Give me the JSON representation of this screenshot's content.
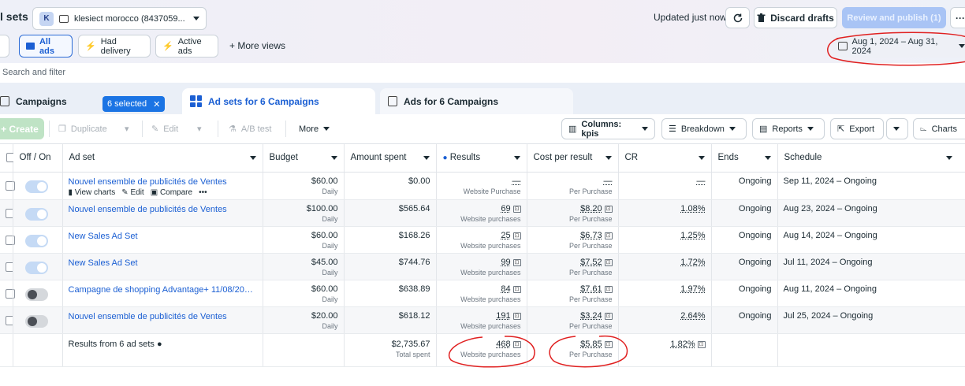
{
  "header": {
    "title": "l sets",
    "account_initial": "K",
    "account_name": "klesiect morocco (8437059...",
    "updated": "Updated just now",
    "discard": "Discard drafts",
    "publish": "Review and publish (1)",
    "more": "···"
  },
  "views": {
    "all_ads": "All ads",
    "had_delivery": "Had delivery",
    "active_ads": "Active ads",
    "more_views": "+  More views",
    "date_range": "Aug 1, 2024 – Aug 31, 2024"
  },
  "search": {
    "placeholder": "Search and filter"
  },
  "tabs": {
    "campaigns": "Campaigns",
    "selected": "6 selected",
    "adsets": "Ad sets for 6 Campaigns",
    "ads": "Ads for 6 Campaigns"
  },
  "toolbar": {
    "create": "+ Create",
    "duplicate": "Duplicate",
    "edit": "Edit",
    "ab_test": "A/B test",
    "more": "More",
    "columns": "Columns: kpis",
    "breakdown": "Breakdown",
    "reports": "Reports",
    "export": "Export",
    "charts": "Charts"
  },
  "columns": [
    "Off / On",
    "Ad set",
    "Budget",
    "Amount spent",
    "Results",
    "Cost per result",
    "CR",
    "Ends",
    "Schedule"
  ],
  "row_actions": [
    "View charts",
    "Edit",
    "Compare",
    "•••"
  ],
  "rows": [
    {
      "name": "Nouvel ensemble de publicités de Ventes",
      "on": true,
      "budget": "$60.00",
      "budget_type": "Daily",
      "spent": "$0.00",
      "results": "—",
      "results_sub": "Website Purchase",
      "cpr": "—",
      "cpr_sub": "Per Purchase",
      "cr": "—",
      "ends": "Ongoing",
      "schedule": "Sep 11, 2024 – Ongoing"
    },
    {
      "name": "Nouvel ensemble de publicités de Ventes",
      "on": true,
      "budget": "$100.00",
      "budget_type": "Daily",
      "spent": "$565.64",
      "results": "69",
      "results_sub": "Website purchases",
      "cpr": "$8.20",
      "cpr_sub": "Per Purchase",
      "cr": "1.08%",
      "ends": "Ongoing",
      "schedule": "Aug 23, 2024 – Ongoing"
    },
    {
      "name": "New Sales Ad Set",
      "on": true,
      "budget": "$60.00",
      "budget_type": "Daily",
      "spent": "$168.26",
      "results": "25",
      "results_sub": "Website purchases",
      "cpr": "$6.73",
      "cpr_sub": "Per Purchase",
      "cr": "1.25%",
      "ends": "Ongoing",
      "schedule": "Aug 14, 2024 – Ongoing"
    },
    {
      "name": "New Sales Ad Set",
      "on": true,
      "budget": "$45.00",
      "budget_type": "Daily",
      "spent": "$744.76",
      "results": "99",
      "results_sub": "Website purchases",
      "cpr": "$7.52",
      "cpr_sub": "Per Purchase",
      "cr": "1.72%",
      "ends": "Ongoing",
      "schedule": "Jul 11, 2024 – Ongoing"
    },
    {
      "name": "Campagne de shopping Advantage+ 11/08/2024 ...",
      "on": false,
      "budget": "$60.00",
      "budget_type": "Daily",
      "spent": "$638.89",
      "results": "84",
      "results_sub": "Website purchases",
      "cpr": "$7.61",
      "cpr_sub": "Per Purchase",
      "cr": "1.97%",
      "ends": "Ongoing",
      "schedule": "Aug 11, 2024 – Ongoing"
    },
    {
      "name": "Nouvel ensemble de publicités de Ventes",
      "on": false,
      "budget": "$20.00",
      "budget_type": "Daily",
      "spent": "$618.12",
      "results": "191",
      "results_sub": "Website purchases",
      "cpr": "$3.24",
      "cpr_sub": "Per Purchase",
      "cr": "2.64%",
      "ends": "Ongoing",
      "schedule": "Jul 25, 2024 – Ongoing"
    }
  ],
  "summary": {
    "label": "Results from 6 ad sets",
    "spent": "$2,735.67",
    "spent_sub": "Total spent",
    "results": "468",
    "results_sub": "Website purchases",
    "cpr": "$5.85",
    "cpr_sub": "Per Purchase",
    "cr": "1.82%"
  },
  "colors": {
    "accent": "#1b5fd3",
    "annotation": "#e02020"
  }
}
